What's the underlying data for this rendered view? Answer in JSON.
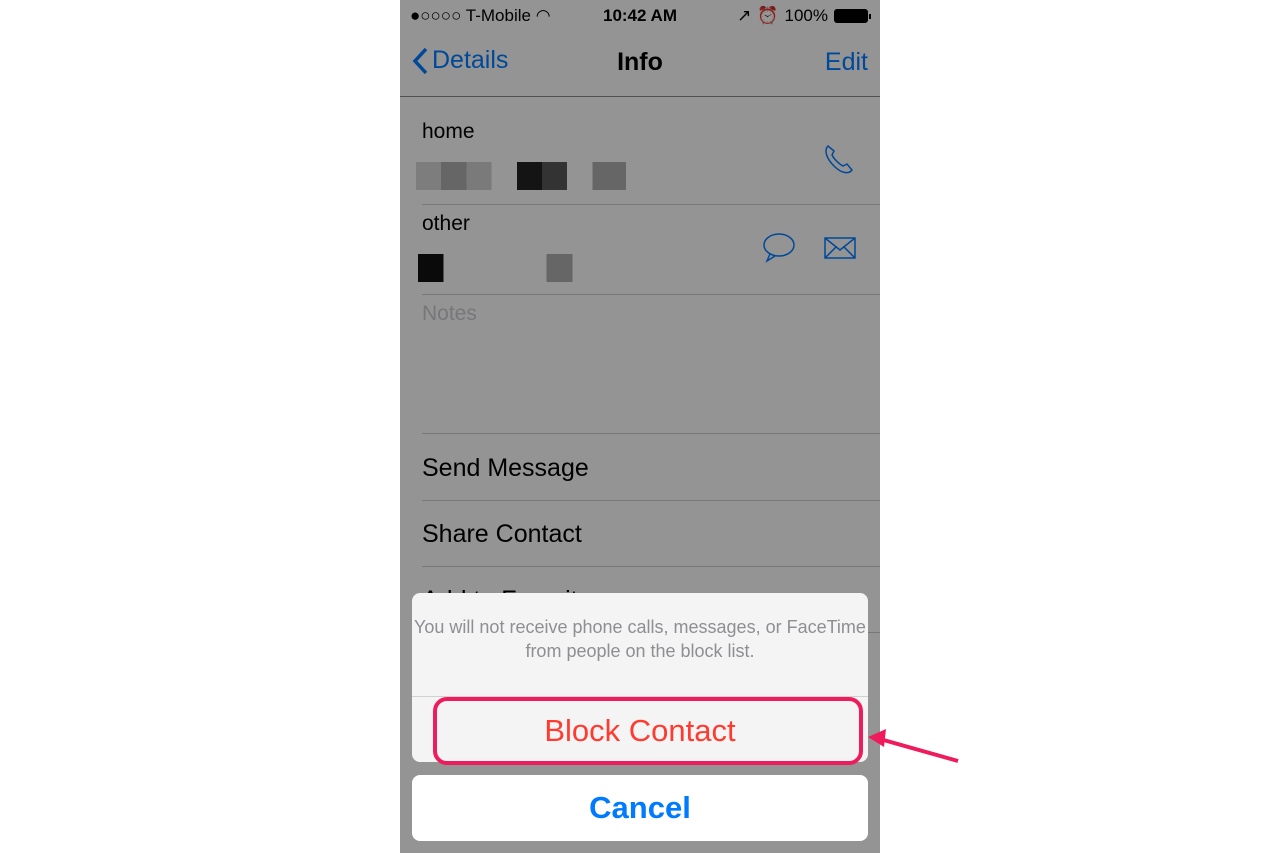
{
  "status_bar": {
    "signal": "●○○○○",
    "carrier": "T-Mobile",
    "time": "10:42 AM",
    "battery": "100%"
  },
  "nav": {
    "back_label": "Details",
    "title": "Info",
    "edit_label": "Edit"
  },
  "fields": [
    {
      "label": "home"
    },
    {
      "label": "other"
    }
  ],
  "notes_label": "Notes",
  "actions": [
    "Send Message",
    "Share Contact",
    "Add to Favorites"
  ],
  "sheet": {
    "message": "You will not receive phone calls, messages, or FaceTime from people on the block list.",
    "block_label": "Block Contact",
    "cancel_label": "Cancel"
  },
  "colors": {
    "destructive": "#ff3b30",
    "accent": "#007aff",
    "annotation": "#ee1c5c"
  }
}
